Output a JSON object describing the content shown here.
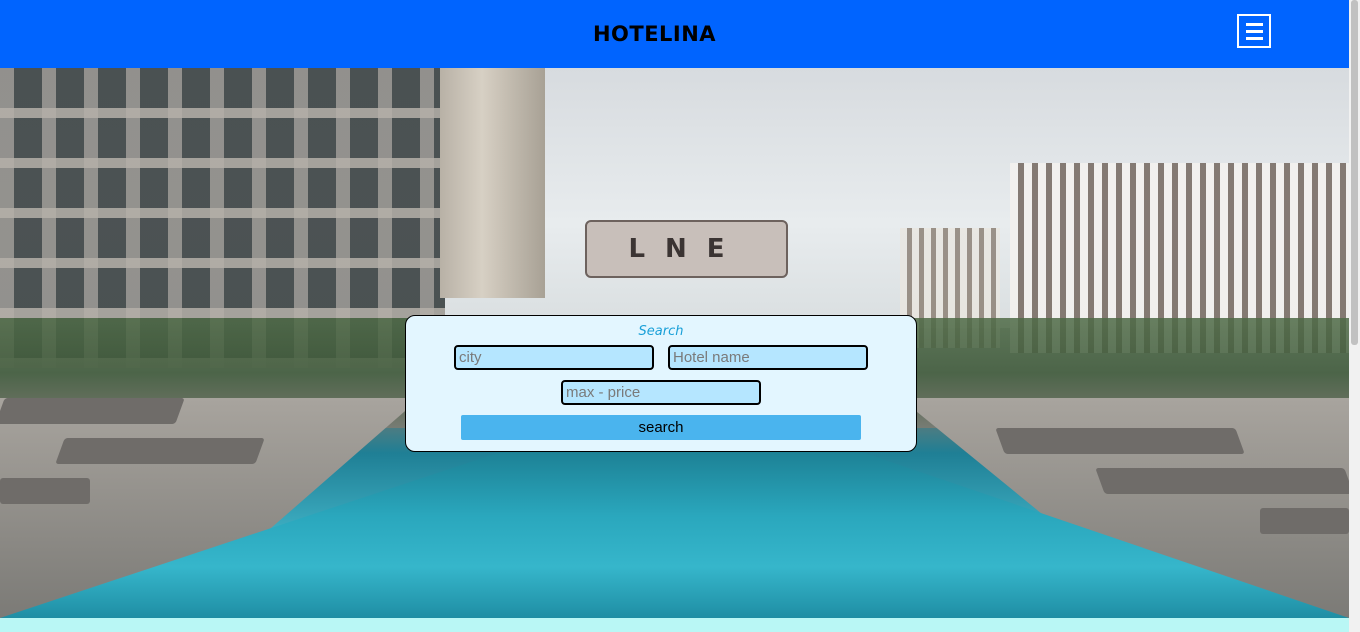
{
  "header": {
    "brand": "HOTELINA",
    "menu_icon": "hamburger-menu-icon",
    "background_color": "#0064ff"
  },
  "hero": {
    "image_description_sign": "LNE"
  },
  "search": {
    "title": "Search",
    "city_placeholder": "city",
    "hotel_placeholder": "Hotel name",
    "price_placeholder": "max - price",
    "button_label": "search",
    "panel_color": "#e3f6ff",
    "field_color": "#b5e6ff",
    "button_color": "#4ab4ee"
  }
}
